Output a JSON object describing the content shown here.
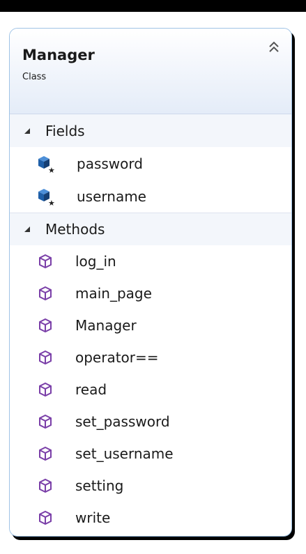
{
  "class": {
    "name": "Manager",
    "stereotype": "Class"
  },
  "sections": {
    "fields": {
      "label": "Fields",
      "items": [
        "password",
        "username"
      ]
    },
    "methods": {
      "label": "Methods",
      "items": [
        "log_in",
        "main_page",
        "Manager",
        "operator==",
        "read",
        "set_password",
        "set_username",
        "setting",
        "write"
      ]
    }
  },
  "icons": {
    "collapse": "double-chevron-up-icon",
    "section_toggle": "triangle-down-icon",
    "field": "field-cube-icon",
    "method": "method-cube-icon"
  },
  "colors": {
    "border": "#9fc3e6",
    "field_icon": "#1f5fa8",
    "method_icon": "#7a3fa8"
  }
}
